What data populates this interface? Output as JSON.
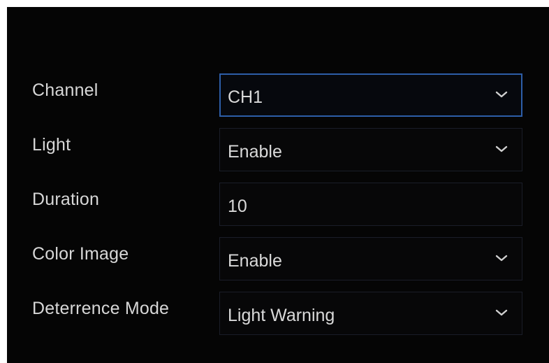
{
  "settings": {
    "rows": [
      {
        "label": "Channel",
        "value": "CH1",
        "control": "dropdown",
        "icon": "chevron-down-icon"
      },
      {
        "label": "Light",
        "value": "Enable",
        "control": "dropdown",
        "icon": "chevron-down-icon"
      },
      {
        "label": "Duration",
        "value": "10",
        "control": "text-input"
      },
      {
        "label": "Color Image",
        "value": "Enable",
        "control": "dropdown",
        "icon": "chevron-down-icon"
      },
      {
        "label": "Deterrence Mode",
        "value": "Light Warning",
        "control": "dropdown",
        "icon": "chevron-down-icon"
      }
    ]
  },
  "colors": {
    "background": "#050505",
    "text": "#d9d9d9",
    "focus_border": "#2d5ea8",
    "field_border": "#1a1d28"
  }
}
